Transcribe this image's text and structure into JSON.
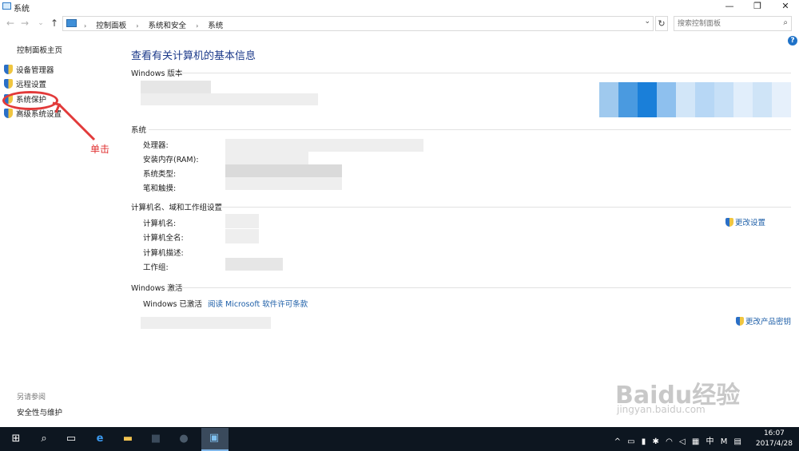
{
  "window": {
    "title": "系统",
    "controls": [
      "—",
      "❐",
      "✕"
    ]
  },
  "nav": {
    "back": "←",
    "forward": "→",
    "recent": "⌄",
    "up": "↑",
    "breadcrumb": [
      "控制面板",
      "系统和安全",
      "系统"
    ],
    "search_placeholder": "搜索控制面板"
  },
  "left_pane": {
    "home": "控制面板主页",
    "items": [
      "设备管理器",
      "远程设置",
      "系统保护",
      "高级系统设置"
    ],
    "see_also": "另请参阅",
    "security": "安全性与维护"
  },
  "annotation": {
    "click_label": "单击"
  },
  "main": {
    "title": "查看有关计算机的基本信息",
    "sections": {
      "windows_edition": "Windows 版本",
      "system": "系统",
      "computer_name": "计算机名、域和工作组设置",
      "activation": "Windows 激活"
    },
    "system_fields": [
      "处理器:",
      "安装内存(RAM):",
      "系统类型:",
      "笔和触摸:"
    ],
    "name_fields": [
      "计算机名:",
      "计算机全名:",
      "计算机描述:",
      "工作组:"
    ],
    "change_settings": "更改设置",
    "activation_status": "Windows 已激活",
    "license_link": "阅读 Microsoft 软件许可条款",
    "change_key": "更改产品密钥"
  },
  "watermark": {
    "brand": "Baidu经验",
    "site": "jingyan.baidu.com"
  },
  "taskbar": {
    "tray_lang": "中",
    "tray_ime": "M",
    "time": "16:07",
    "date": "2017/4/28"
  },
  "colors": {
    "link": "#1e5fa8",
    "title": "#1c3a8a",
    "annotation": "#e23a3a",
    "taskbar": "#0d1620"
  }
}
